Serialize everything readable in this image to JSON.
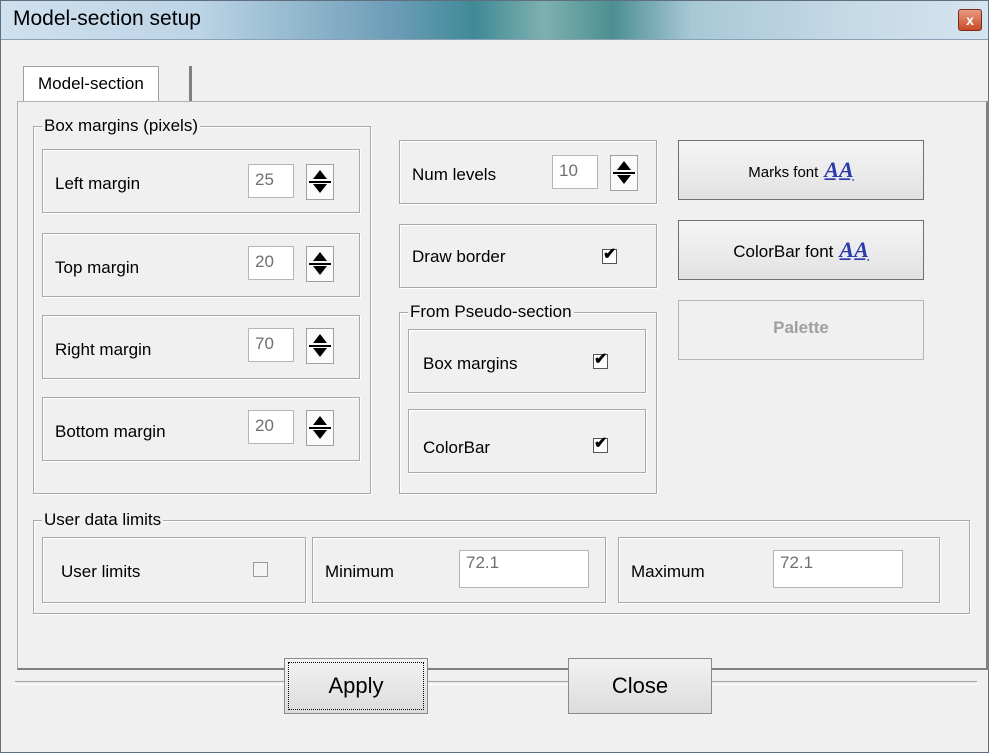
{
  "window": {
    "title": "Model-section setup",
    "close_glyph": "x"
  },
  "tab": {
    "label": "Model-section"
  },
  "box_margins": {
    "legend": "Box margins (pixels)",
    "left": {
      "label": "Left margin",
      "value": "25"
    },
    "top": {
      "label": "Top margin",
      "value": "20"
    },
    "right": {
      "label": "Right margin",
      "value": "70"
    },
    "bottom": {
      "label": "Bottom margin",
      "value": "20"
    }
  },
  "num_levels": {
    "label": "Num levels",
    "value": "10"
  },
  "draw_border": {
    "label": "Draw border",
    "checked": true
  },
  "pseudo": {
    "legend": "From Pseudo-section",
    "box_margins": {
      "label": "Box margins",
      "checked": true
    },
    "colorbar": {
      "label": "ColorBar",
      "checked": true
    }
  },
  "buttons": {
    "marks_font": "Marks font",
    "colorbar_font": "ColorBar font",
    "palette": "Palette",
    "font_icon_text": "A̲A̲"
  },
  "user_limits": {
    "legend": "User data limits",
    "user_limits_label": "User limits",
    "user_limits_checked": false,
    "minimum_label": "Minimum",
    "minimum_value": "72.1",
    "maximum_label": "Maximum",
    "maximum_value": "72.1"
  },
  "footer": {
    "apply": "Apply",
    "close": "Close"
  },
  "check_glyph": "✔"
}
